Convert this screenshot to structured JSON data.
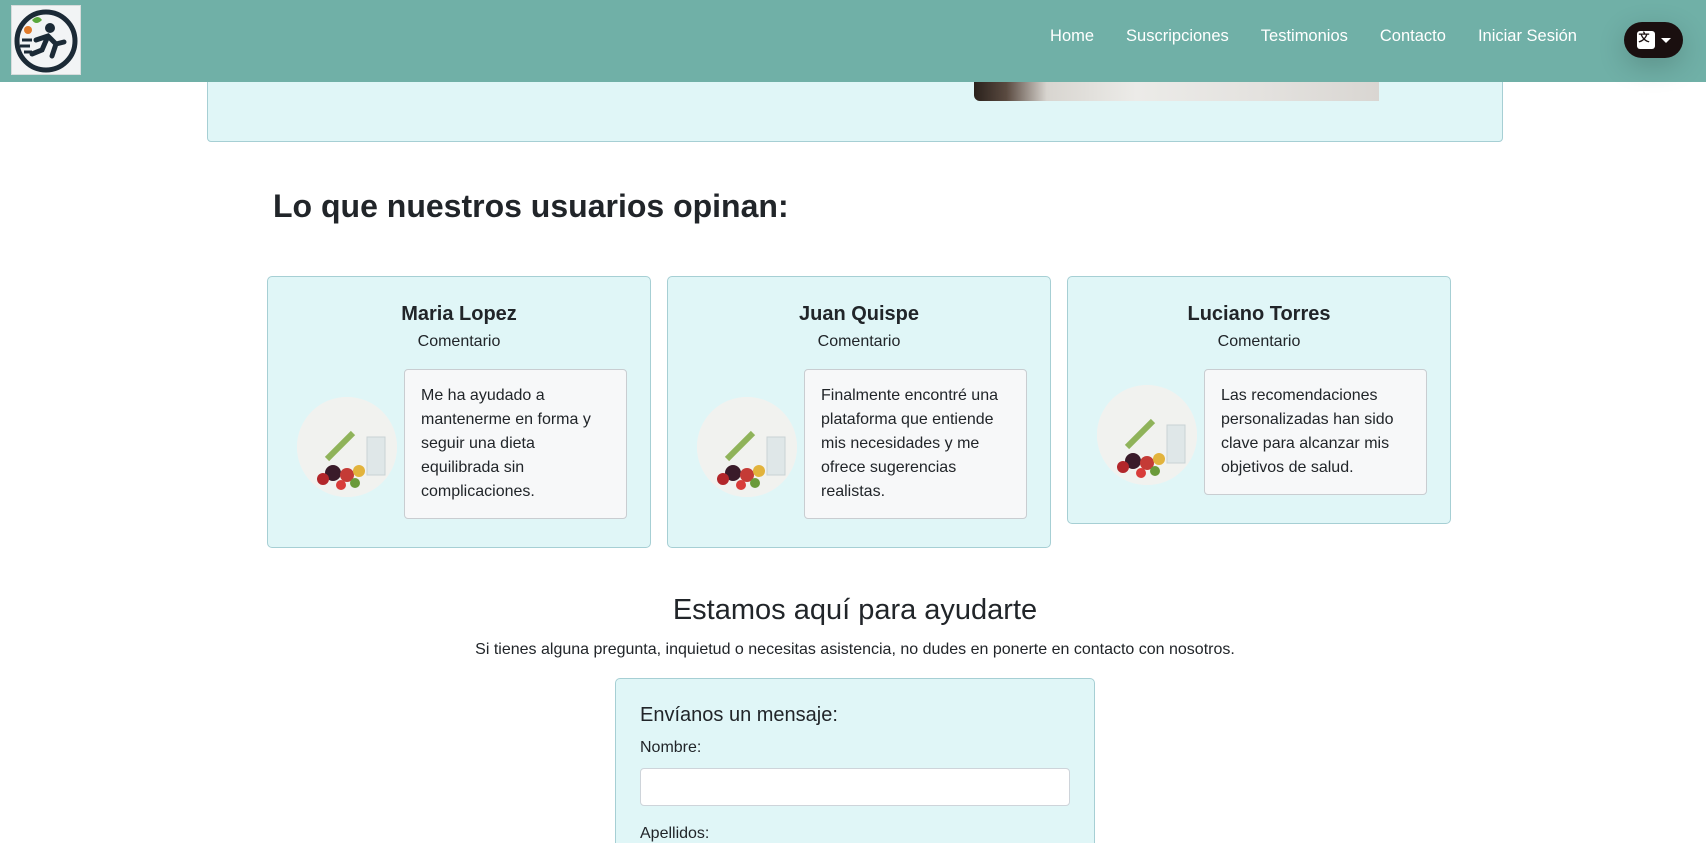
{
  "navbar": {
    "logo_alt": "logo",
    "links": [
      "Home",
      "Suscripciones",
      "Testimonios",
      "Contacto",
      "Iniciar Sesión"
    ],
    "language_icon": "translate-icon",
    "background": "#70b0a7"
  },
  "testimonials": {
    "title": "Lo que nuestros usuarios opinan:",
    "items": [
      {
        "name": "Maria Lopez",
        "subtitle": "Comentario",
        "text": "Me ha ayudado a mantenerme en forma y seguir una dieta equilibrada sin complicaciones."
      },
      {
        "name": "Juan Quispe",
        "subtitle": "Comentario",
        "text": "Finalmente encontré una plataforma que entiende mis necesidades y me ofrece sugerencias realistas."
      },
      {
        "name": "Luciano Torres",
        "subtitle": "Comentario",
        "text": "Las recomendaciones personalizadas han sido clave para alcanzar mis objetivos de salud."
      }
    ],
    "card_color": "#e0f6f7"
  },
  "contact": {
    "title": "Estamos aquí para ayudarte",
    "subtitle": "Si tienes alguna pregunta, inquietud o necesitas asistencia, no dudes en ponerte en contacto con nosotros.",
    "form": {
      "title": "Envíanos un mensaje:",
      "name_label": "Nombre:",
      "name_value": "",
      "lastname_label": "Apellidos:"
    }
  }
}
